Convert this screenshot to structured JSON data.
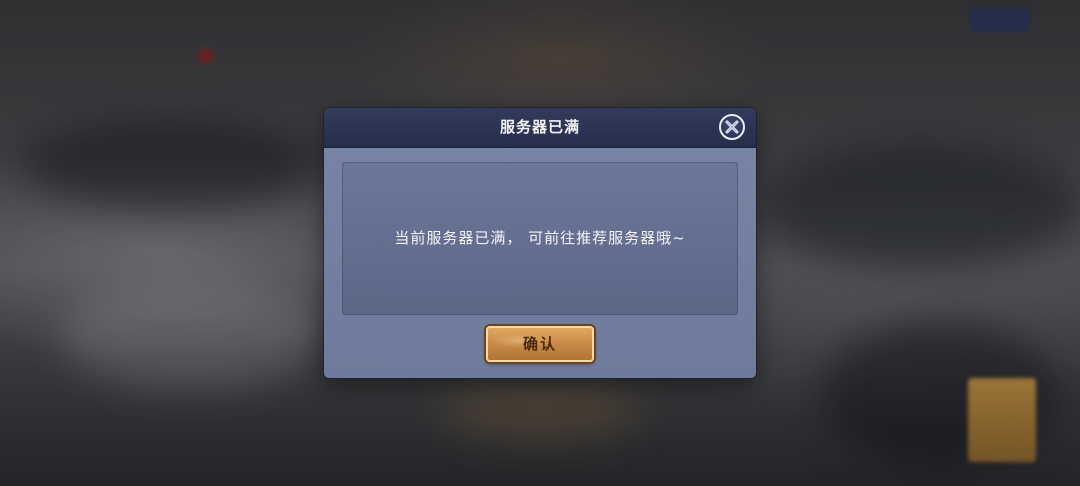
{
  "dialog": {
    "title": "服务器已满",
    "message": "当前服务器已满， 可前往推荐服务器哦~",
    "confirm_label": "确认",
    "close_icon": "close-icon"
  },
  "colors": {
    "header": "#2b3352",
    "body": "#7480a2",
    "panel": "#66729a",
    "button": "#c88a46",
    "button_text": "#4a2a10",
    "title_text": "#f2f2f4"
  }
}
